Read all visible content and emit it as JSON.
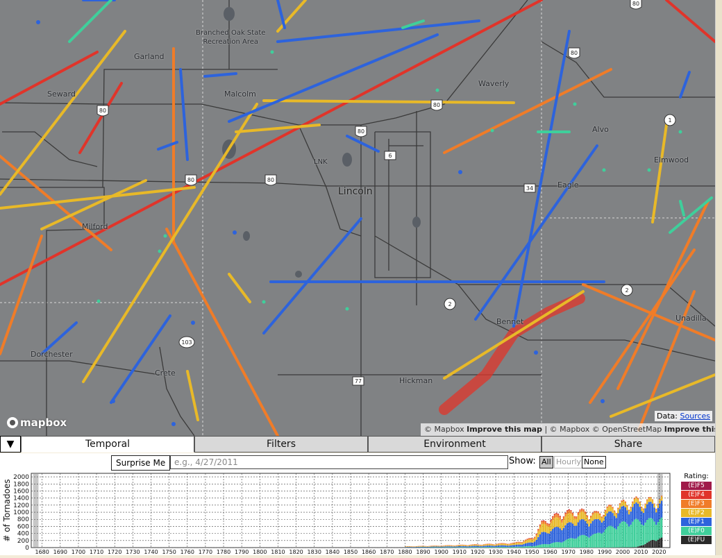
{
  "map": {
    "labels": [
      {
        "id": "branched-oak",
        "text": "Branched Oak State\nRecreation Area",
        "type": "park"
      },
      {
        "id": "garland",
        "text": "Garland"
      },
      {
        "id": "seward",
        "text": "Seward"
      },
      {
        "id": "malcolm",
        "text": "Malcolm"
      },
      {
        "id": "waverly",
        "text": "Waverly"
      },
      {
        "id": "alvo",
        "text": "Alvo"
      },
      {
        "id": "elmwood",
        "text": "Elmwood"
      },
      {
        "id": "lnk",
        "text": "LNK"
      },
      {
        "id": "lincoln",
        "text": "Lincoln",
        "type": "city"
      },
      {
        "id": "eagle",
        "text": "Eagle"
      },
      {
        "id": "milford",
        "text": "Milford"
      },
      {
        "id": "bennet",
        "text": "Bennet"
      },
      {
        "id": "unadilla",
        "text": "Unadilla"
      },
      {
        "id": "dorchester",
        "text": "Dorchester"
      },
      {
        "id": "crete",
        "text": "Crete"
      },
      {
        "id": "hickman",
        "text": "Hickman"
      }
    ],
    "shields": [
      "80",
      "80",
      "80",
      "80",
      "80",
      "80",
      "80",
      "6",
      "34",
      "1",
      "2",
      "2",
      "103",
      "77"
    ],
    "logo_text": "mapbox",
    "data_label": "Data:",
    "sources_link": "Sources",
    "attribution": {
      "part1": "© Mapbox",
      "improve": "Improve this map",
      "sep": " | © Mapbox © OpenStreetMap",
      "improve2": "Improve this map"
    },
    "colors": {
      "background": "#808284",
      "ef0": "#3fcf9b",
      "ef1": "#2d63dc",
      "ef2": "#e8b928",
      "ef3": "#f07c28",
      "ef4": "#e0342a"
    }
  },
  "tabs": {
    "collapse_icon": "▼",
    "items": [
      "Temporal",
      "Filters",
      "Environment",
      "Share"
    ],
    "active": "Temporal"
  },
  "controls": {
    "surprise_label": "Surprise Me",
    "date_placeholder": "e.g., 4/27/2011",
    "show_label": "Show:",
    "show_all": "All",
    "show_hourly": "Hourly",
    "show_none": "None"
  },
  "legend": {
    "title": "Rating:",
    "items": [
      {
        "label": "(E)F5",
        "color": "#a01a4a"
      },
      {
        "label": "(E)F4",
        "color": "#e0342a"
      },
      {
        "label": "(E)F3",
        "color": "#f07c28"
      },
      {
        "label": "(E)F2",
        "color": "#e8b928"
      },
      {
        "label": "(E)F1",
        "color": "#2d63dc"
      },
      {
        "label": "(E)F0",
        "color": "#3fcf9b"
      },
      {
        "label": "(E)FU",
        "color": "#2a2a2a"
      }
    ]
  },
  "chart_data": {
    "type": "bar",
    "ylabel": "# of Tornadoes",
    "yticks": [
      0,
      200,
      400,
      600,
      800,
      1000,
      1200,
      1400,
      1600,
      1800,
      2000
    ],
    "ylim": [
      0,
      2100
    ],
    "xlim": [
      1674,
      2026
    ],
    "xticks": [
      1680,
      1690,
      1700,
      1710,
      1720,
      1730,
      1740,
      1750,
      1760,
      1770,
      1780,
      1790,
      1800,
      1810,
      1820,
      1830,
      1840,
      1850,
      1860,
      1870,
      1880,
      1890,
      1900,
      1910,
      1920,
      1930,
      1940,
      1950,
      1960,
      1970,
      1980,
      1990,
      2000,
      2010,
      2020
    ],
    "grid": true,
    "series_order": [
      "(E)FU",
      "(E)F0",
      "(E)F1",
      "(E)F2",
      "(E)F3",
      "(E)F4",
      "(E)F5"
    ],
    "anchors": [
      {
        "year": 1880,
        "FU": 0,
        "F0": 5,
        "F1": 10,
        "F2": 10,
        "F3": 5,
        "F4": 2,
        "F5": 0
      },
      {
        "year": 1900,
        "FU": 0,
        "F0": 10,
        "F1": 20,
        "F2": 15,
        "F3": 8,
        "F4": 3,
        "F5": 0
      },
      {
        "year": 1920,
        "FU": 0,
        "F0": 15,
        "F1": 30,
        "F2": 25,
        "F3": 10,
        "F4": 4,
        "F5": 1
      },
      {
        "year": 1940,
        "FU": 0,
        "F0": 20,
        "F1": 45,
        "F2": 40,
        "F3": 15,
        "F4": 5,
        "F5": 1
      },
      {
        "year": 1950,
        "FU": 0,
        "F0": 40,
        "F1": 100,
        "F2": 80,
        "F3": 30,
        "F4": 10,
        "F5": 2
      },
      {
        "year": 1955,
        "FU": 0,
        "F0": 80,
        "F1": 300,
        "F2": 200,
        "F3": 60,
        "F4": 20,
        "F5": 4
      },
      {
        "year": 1965,
        "FU": 0,
        "F0": 150,
        "F1": 400,
        "F2": 250,
        "F3": 80,
        "F4": 25,
        "F5": 4
      },
      {
        "year": 1975,
        "FU": 0,
        "F0": 300,
        "F1": 400,
        "F2": 200,
        "F3": 60,
        "F4": 15,
        "F5": 3
      },
      {
        "year": 1985,
        "FU": 0,
        "F0": 350,
        "F1": 350,
        "F2": 150,
        "F3": 40,
        "F4": 10,
        "F5": 2
      },
      {
        "year": 1990,
        "FU": 0,
        "F0": 500,
        "F1": 350,
        "F2": 130,
        "F3": 35,
        "F4": 8,
        "F5": 2
      },
      {
        "year": 2000,
        "FU": 5,
        "F0": 650,
        "F1": 380,
        "F2": 110,
        "F3": 30,
        "F4": 6,
        "F5": 1
      },
      {
        "year": 2007,
        "FU": 10,
        "F0": 700,
        "F1": 400,
        "F2": 110,
        "F3": 30,
        "F4": 6,
        "F5": 2
      },
      {
        "year": 2012,
        "FU": 100,
        "F0": 600,
        "F1": 400,
        "F2": 100,
        "F3": 25,
        "F4": 5,
        "F5": 1
      },
      {
        "year": 2016,
        "FU": 200,
        "F0": 550,
        "F1": 400,
        "F2": 90,
        "F3": 20,
        "F4": 4,
        "F5": 0
      },
      {
        "year": 2021,
        "FU": 250,
        "F0": 500,
        "F1": 420,
        "F2": 100,
        "F3": 20,
        "F4": 4,
        "F5": 0
      }
    ],
    "highlight_ranges": [
      [
        1675,
        1678
      ],
      [
        2019,
        2022
      ]
    ]
  }
}
